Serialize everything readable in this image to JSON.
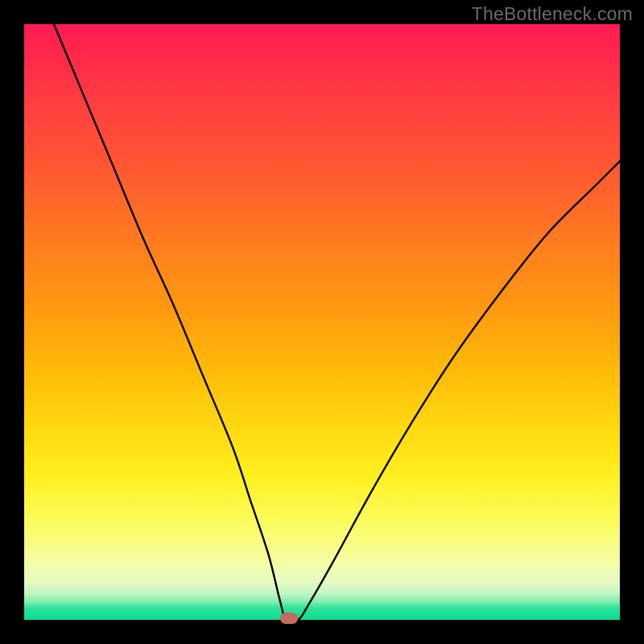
{
  "watermark": "TheBottleneck.com",
  "colors": {
    "frame": "#000000",
    "curve": "#000000",
    "marker": "#c96a5e"
  },
  "chart_data": {
    "type": "line",
    "title": "",
    "xlabel": "",
    "ylabel": "",
    "xlim": [
      0,
      100
    ],
    "ylim": [
      0,
      100
    ],
    "grid": false,
    "legend": false,
    "note": "V-shaped bottleneck curve on red→green vertical gradient. Y is mismatch % (0 = ideal, at bottom green band). Minimum near x≈44 where the small rounded marker sits on the x-axis.",
    "series": [
      {
        "name": "bottleneck-curve",
        "x": [
          5,
          10,
          15,
          20,
          25,
          30,
          35,
          38,
          41,
          43,
          44,
          46,
          48,
          52,
          58,
          65,
          72,
          80,
          88,
          96,
          100
        ],
        "y": [
          100,
          88,
          76,
          64,
          53,
          41,
          29,
          20,
          11,
          3,
          0,
          0,
          3,
          10,
          21,
          33,
          44,
          55,
          65,
          73,
          77
        ]
      }
    ],
    "marker": {
      "x": 44.5,
      "y": 0
    },
    "background_gradient": {
      "direction": "vertical",
      "stops": [
        {
          "pos": 0.0,
          "color": "#ff1a54"
        },
        {
          "pos": 0.25,
          "color": "#ff5a30"
        },
        {
          "pos": 0.58,
          "color": "#ffba08"
        },
        {
          "pos": 0.84,
          "color": "#fafd60"
        },
        {
          "pos": 0.95,
          "color": "#c3f6c6"
        },
        {
          "pos": 1.0,
          "color": "#07dd94"
        }
      ]
    }
  }
}
